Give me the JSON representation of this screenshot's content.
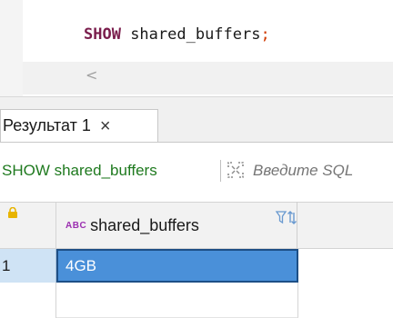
{
  "editor": {
    "sql_keyword": "SHOW",
    "sql_rest": " shared_buffers",
    "sql_terminator": ";",
    "scroll_left_glyph": "<"
  },
  "results_tab": {
    "label": "Результат 1",
    "close_glyph": "×"
  },
  "query_bar": {
    "query_text": "SHOW shared_buffers",
    "filter_placeholder": "Введите SQL"
  },
  "grid": {
    "columns": [
      {
        "type_badge": "ABC",
        "name": "shared_buffers"
      }
    ],
    "rows": [
      {
        "row_number": "1",
        "values": [
          "4GB"
        ]
      }
    ]
  },
  "icons": [
    "scroll-left-icon",
    "close-icon",
    "expand-icon",
    "lock-icon",
    "filter-icon",
    "sort-icon"
  ],
  "colors": {
    "keyword": "#7a1d4c",
    "query_text": "#1f7a1f",
    "selected_cell": "#4a90d9",
    "row_number_bg": "#cfe3f5",
    "type_badge": "#9b2fb0"
  }
}
